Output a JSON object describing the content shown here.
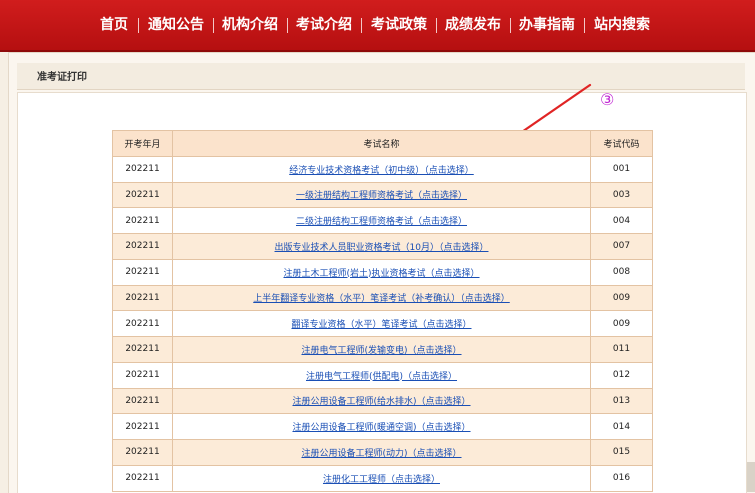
{
  "nav": [
    {
      "label": "首页"
    },
    {
      "label": "通知公告"
    },
    {
      "label": "机构介绍"
    },
    {
      "label": "考试介绍"
    },
    {
      "label": "考试政策"
    },
    {
      "label": "成绩发布"
    },
    {
      "label": "办事指南"
    },
    {
      "label": "站内搜索"
    }
  ],
  "panel": {
    "title": "准考证打印"
  },
  "annotation": {
    "marker": "③",
    "color": "#e02424"
  },
  "table": {
    "headers": {
      "period": "开考年月",
      "name": "考试名称",
      "code": "考试代码"
    },
    "rows": [
      {
        "period": "202211",
        "name": "经济专业技术资格考试（初中级）（点击选择）",
        "code": "001"
      },
      {
        "period": "202211",
        "name": "一级注册结构工程师资格考试（点击选择）",
        "code": "003"
      },
      {
        "period": "202211",
        "name": "二级注册结构工程师资格考试（点击选择）",
        "code": "004"
      },
      {
        "period": "202211",
        "name": "出版专业技术人员职业资格考试（10月）（点击选择）",
        "code": "007"
      },
      {
        "period": "202211",
        "name": "注册土木工程师(岩土)执业资格考试（点击选择）",
        "code": "008"
      },
      {
        "period": "202211",
        "name": "上半年翻译专业资格（水平）笔译考试（补考确认）（点击选择）",
        "code": "009"
      },
      {
        "period": "202211",
        "name": "翻译专业资格（水平）笔译考试（点击选择）",
        "code": "009"
      },
      {
        "period": "202211",
        "name": "注册电气工程师(发输变电)（点击选择）",
        "code": "011"
      },
      {
        "period": "202211",
        "name": "注册电气工程师(供配电)（点击选择）",
        "code": "012"
      },
      {
        "period": "202211",
        "name": "注册公用设备工程师(给水排水)（点击选择）",
        "code": "013"
      },
      {
        "period": "202211",
        "name": "注册公用设备工程师(暖通空调)（点击选择）",
        "code": "014"
      },
      {
        "period": "202211",
        "name": "注册公用设备工程师(动力)（点击选择）",
        "code": "015"
      },
      {
        "period": "202211",
        "name": "注册化工工程师（点击选择）",
        "code": "016"
      }
    ]
  }
}
